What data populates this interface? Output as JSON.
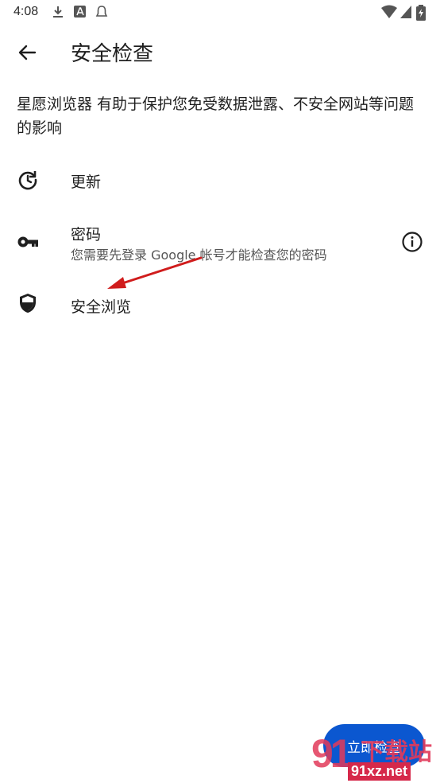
{
  "status_bar": {
    "time": "4:08",
    "icons": [
      "download-icon",
      "a-badge-icon",
      "notification-icon",
      "wifi-icon",
      "signal-icon",
      "battery-icon"
    ]
  },
  "header": {
    "back_icon": "arrow-left-icon",
    "title": "安全检查"
  },
  "description": "星愿浏览器 有助于保护您免受数据泄露、不安全网站等问题的影响",
  "checks": [
    {
      "icon": "update-icon",
      "title": "更新"
    },
    {
      "icon": "key-icon",
      "title": "密码",
      "subtitle": "您需要先登录 Google 帐号才能检查您的密码",
      "action_icon": "info-icon"
    },
    {
      "icon": "shield-icon",
      "title": "安全浏览"
    }
  ],
  "fab": {
    "label": "立即检查"
  },
  "annotation": {
    "icon": "red-arrow-annotation"
  },
  "watermark": {
    "digits": "91",
    "site_name": "下载站",
    "url": "91xz.net"
  },
  "colors": {
    "accent": "#0b57d0",
    "annotation_red": "#d01c1c",
    "watermark": "#e23a5a"
  }
}
